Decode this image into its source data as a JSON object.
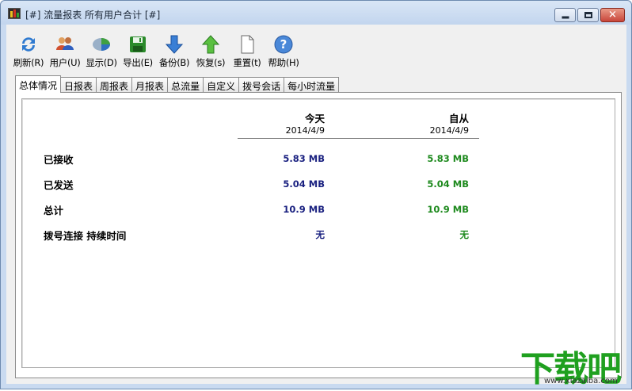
{
  "window": {
    "title": "[#] 流量报表 所有用户合计 [#]"
  },
  "toolbar": {
    "items": [
      {
        "label": "刷新(R)",
        "icon": "refresh-icon"
      },
      {
        "label": "用户(U)",
        "icon": "users-icon"
      },
      {
        "label": "显示(D)",
        "icon": "display-icon"
      },
      {
        "label": "导出(E)",
        "icon": "save-icon"
      },
      {
        "label": "备份(B)",
        "icon": "backup-arrow-down-icon"
      },
      {
        "label": "恢复(s)",
        "icon": "restore-arrow-up-icon"
      },
      {
        "label": "重置(t)",
        "icon": "blank-page-icon"
      },
      {
        "label": "帮助(H)",
        "icon": "help-icon"
      }
    ]
  },
  "tabs": [
    "总体情况",
    "日报表",
    "周报表",
    "月报表",
    "总流量",
    "自定义",
    "拨号会话",
    "每小时流量"
  ],
  "report": {
    "col_today": "今天",
    "col_today_date": "2014/4/9",
    "col_since": "自从",
    "col_since_date": "2014/4/9",
    "rows": [
      {
        "label": "已接收",
        "today": "5.83 MB",
        "since": "5.83 MB"
      },
      {
        "label": "已发送",
        "today": "5.04 MB",
        "since": "5.04 MB"
      },
      {
        "label": "总计",
        "today": "10.9 MB",
        "since": "10.9 MB"
      },
      {
        "label": "拨号连接 持续时间",
        "today": "无",
        "since": "无"
      }
    ]
  },
  "watermark": {
    "brand": "下载吧",
    "url": "www.xiazaiba.com"
  },
  "colors": {
    "today_value": "#1a2180",
    "since_value": "#1e8a1e",
    "watermark": "#1fa01f"
  }
}
